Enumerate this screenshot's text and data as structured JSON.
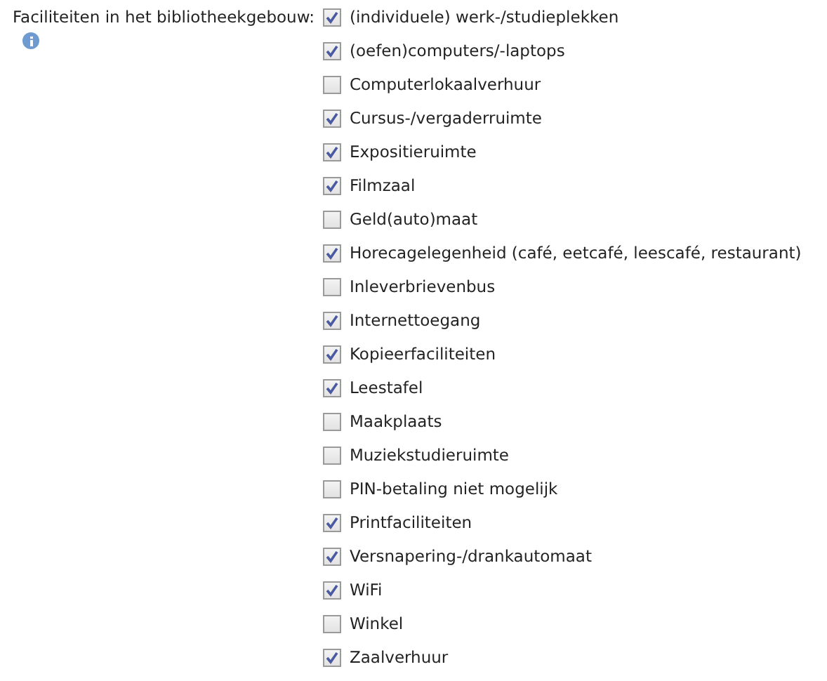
{
  "field": {
    "label": "Faciliteiten in het bibliotheekgebouw:",
    "options": [
      {
        "label": "(individuele) werk-/studieplekken",
        "checked": true
      },
      {
        "label": "(oefen)computers/-laptops",
        "checked": true
      },
      {
        "label": "Computerlokaalverhuur",
        "checked": false
      },
      {
        "label": "Cursus-/vergaderruimte",
        "checked": true
      },
      {
        "label": "Expositieruimte",
        "checked": true
      },
      {
        "label": "Filmzaal",
        "checked": true
      },
      {
        "label": "Geld(auto)maat",
        "checked": false
      },
      {
        "label": "Horecagelegenheid (café, eetcafé, leescafé, restaurant)",
        "checked": true
      },
      {
        "label": "Inleverbrievenbus",
        "checked": false
      },
      {
        "label": "Internettoegang",
        "checked": true
      },
      {
        "label": "Kopieerfaciliteiten",
        "checked": true
      },
      {
        "label": "Leestafel",
        "checked": true
      },
      {
        "label": "Maakplaats",
        "checked": false
      },
      {
        "label": "Muziekstudieruimte",
        "checked": false
      },
      {
        "label": "PIN-betaling niet mogelijk",
        "checked": false
      },
      {
        "label": "Printfaciliteiten",
        "checked": true
      },
      {
        "label": "Versnapering-/drankautomaat",
        "checked": true
      },
      {
        "label": "WiFi",
        "checked": true
      },
      {
        "label": "Winkel",
        "checked": false
      },
      {
        "label": "Zaalverhuur",
        "checked": true
      }
    ]
  }
}
